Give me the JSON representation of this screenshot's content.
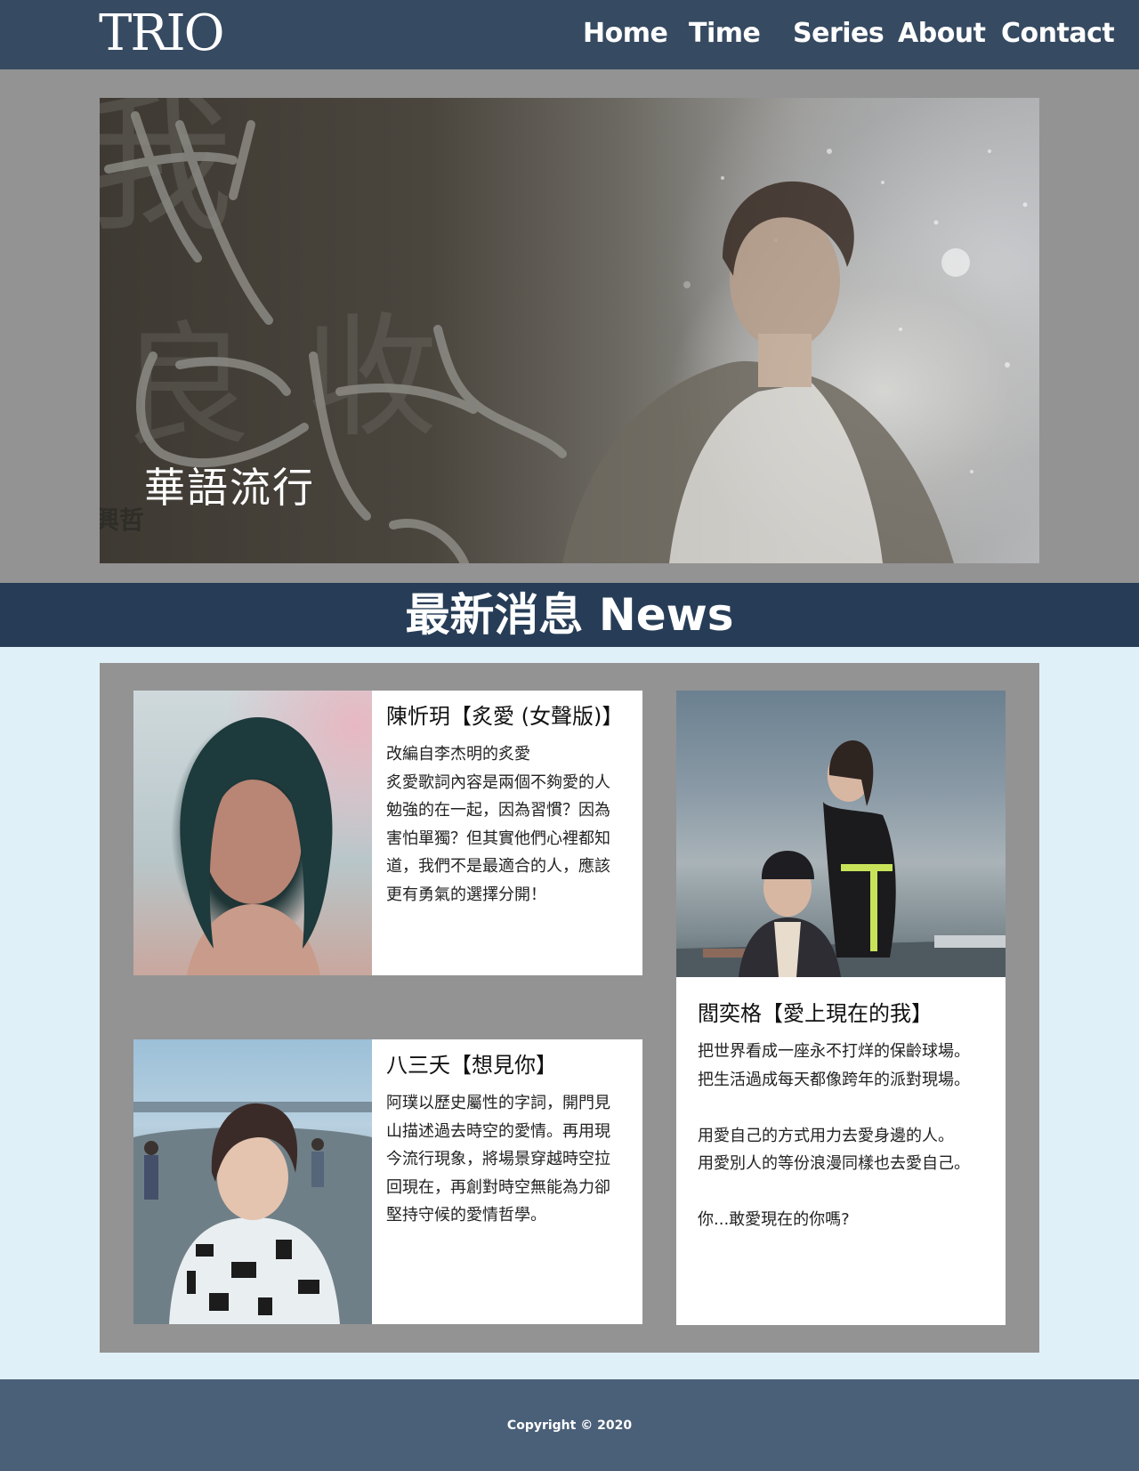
{
  "header": {
    "logo_text": "TRIO",
    "nav": [
      {
        "label": "Home"
      },
      {
        "label": "Time"
      },
      {
        "label": "Series"
      },
      {
        "label": "About"
      },
      {
        "label": "Contact"
      }
    ]
  },
  "hero": {
    "caption": "華語流行",
    "artwork_text": [
      "我",
      "良",
      "收",
      "興哲"
    ]
  },
  "news": {
    "title": "最新消息 News",
    "items": [
      {
        "title": "陳忻玥【炙愛 (女聲版)】",
        "lines": [
          "改編自李杰明的炙愛",
          "炙愛歌詞內容是兩個不夠愛的人",
          "勉強的在一起，因為習慣？因為",
          "害怕單獨？但其實他們心裡都知",
          "道，我們不是最適合的人，應該",
          "更有勇氣的選擇分開！"
        ]
      },
      {
        "title": "八三夭【想見你】",
        "lines": [
          "阿璞以歷史屬性的字詞，開門見",
          "山描述過去時空的愛情。再用現",
          "今流行現象，將場景穿越時空拉",
          "回現在，再創對時空無能為力卻",
          "堅持守候的愛情哲學。"
        ]
      },
      {
        "title": "閻奕格【愛上現在的我】",
        "lines": [
          "把世界看成一座永不打烊的保齡球場。",
          "把生活過成每天都像跨年的派對現場。",
          "",
          "用愛自己的方式用力去愛身邊的人。",
          "用愛別人的等份浪漫同樣也去愛自己。",
          "",
          "你...敢愛現在的你嗎?"
        ]
      }
    ]
  },
  "footer": {
    "copyright": "Copyright © 2020"
  }
}
